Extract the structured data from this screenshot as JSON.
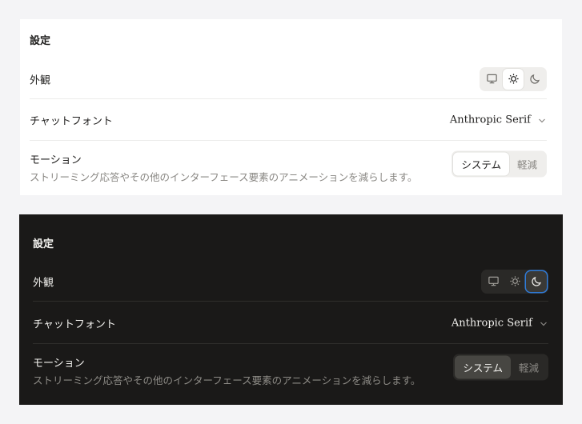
{
  "colors": {
    "page_background": "#f4f4f6",
    "light_panel": "#ffffff",
    "dark_panel": "#1a1918",
    "focus_ring": "#2f7bd8"
  },
  "light": {
    "title": "設定",
    "appearance": {
      "label": "外観",
      "options": [
        "monitor-icon",
        "sun-icon",
        "moon-icon"
      ],
      "selected": "sun-icon"
    },
    "chat_font": {
      "label": "チャットフォント",
      "value": "Anthropic Serif"
    },
    "motion": {
      "label": "モーション",
      "description": "ストリーミング応答やその他のインターフェース要素のアニメーションを減らします。",
      "options": [
        "システム",
        "軽減"
      ],
      "selected": "システム"
    }
  },
  "dark": {
    "title": "設定",
    "appearance": {
      "label": "外観",
      "options": [
        "monitor-icon",
        "sun-icon",
        "moon-icon"
      ],
      "selected": "moon-icon"
    },
    "chat_font": {
      "label": "チャットフォント",
      "value": "Anthropic Serif"
    },
    "motion": {
      "label": "モーション",
      "description": "ストリーミング応答やその他のインターフェース要素のアニメーションを減らします。",
      "options": [
        "システム",
        "軽減"
      ],
      "selected": "システム"
    }
  }
}
